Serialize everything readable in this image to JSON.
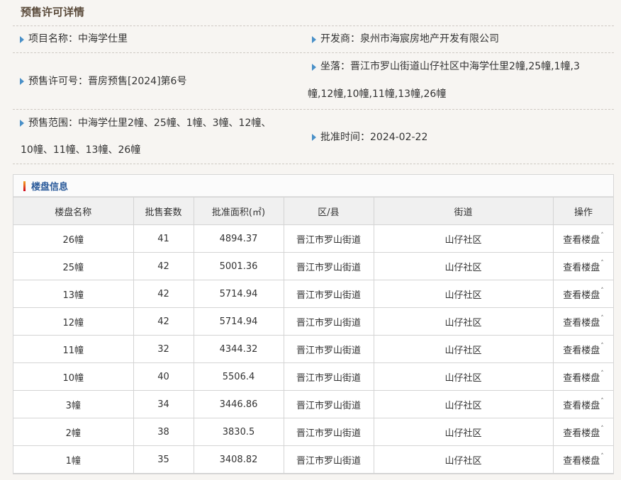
{
  "title": "预售许可详情",
  "info": {
    "project_name": "项目名称：中海学仕里",
    "developer": "开发商：泉州市海宸房地产开发有限公司",
    "permit_number": "预售许可号：晋房预售[2024]第6号",
    "location_line1": "坐落：晋江市罗山街道山仔社区中海学仕里2幢,25幢,1幢,3",
    "location_line2": "幢,12幢,10幢,11幢,13幢,26幢",
    "sale_range_line1": "预售范围：中海学仕里2幢、25幢、1幢、3幢、12幢、",
    "sale_range_line2": "10幢、11幢、13幢、26幢",
    "approval_date": "批准时间：2024-02-22"
  },
  "panel": {
    "title": "楼盘信息",
    "columns": [
      "楼盘名称",
      "批售套数",
      "批准面积(㎡)",
      "区/县",
      "街道",
      "操作"
    ],
    "rows": [
      [
        "26幢",
        "41",
        "4894.37",
        "晋江市罗山街道",
        "山仔社区",
        "查看楼盘"
      ],
      [
        "25幢",
        "42",
        "5001.36",
        "晋江市罗山街道",
        "山仔社区",
        "查看楼盘"
      ],
      [
        "13幢",
        "42",
        "5714.94",
        "晋江市罗山街道",
        "山仔社区",
        "查看楼盘"
      ],
      [
        "12幢",
        "42",
        "5714.94",
        "晋江市罗山街道",
        "山仔社区",
        "查看楼盘"
      ],
      [
        "11幢",
        "32",
        "4344.32",
        "晋江市罗山街道",
        "山仔社区",
        "查看楼盘"
      ],
      [
        "10幢",
        "40",
        "5506.4",
        "晋江市罗山街道",
        "山仔社区",
        "查看楼盘"
      ],
      [
        "3幢",
        "34",
        "3446.86",
        "晋江市罗山街道",
        "山仔社区",
        "查看楼盘"
      ],
      [
        "2幢",
        "38",
        "3830.5",
        "晋江市罗山街道",
        "山仔社区",
        "查看楼盘"
      ],
      [
        "1幢",
        "35",
        "3408.82",
        "晋江市罗山街道",
        "山仔社区",
        "查看楼盘"
      ]
    ]
  }
}
